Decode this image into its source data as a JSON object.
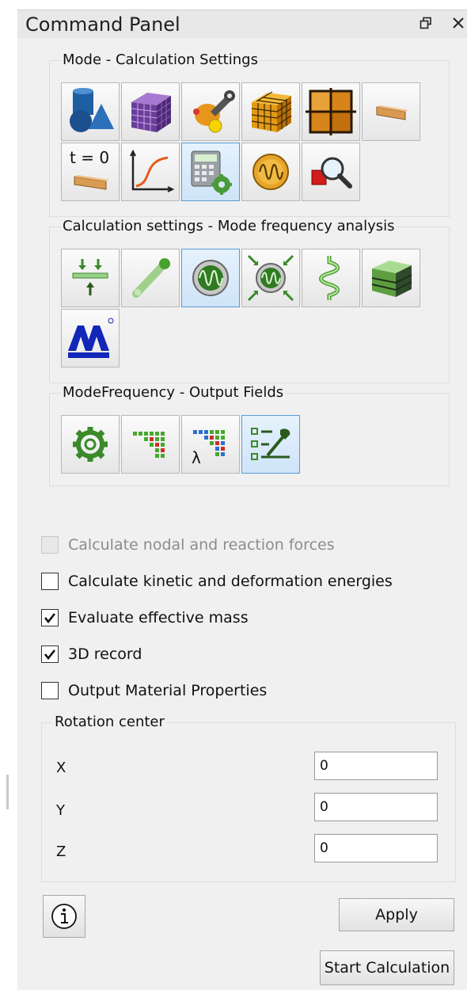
{
  "panel": {
    "title": "Command Panel",
    "float_icon": "restore-icon",
    "close_icon": "close-icon"
  },
  "mode_group": {
    "title": "Mode - Calculation Settings",
    "buttons": [
      {
        "icon": "geometry-icon",
        "active": false
      },
      {
        "icon": "mesh-cube-icon",
        "active": false
      },
      {
        "icon": "tools-icon",
        "active": false
      },
      {
        "icon": "grid-cube-icon",
        "active": false
      },
      {
        "icon": "plate-grid-icon",
        "active": false
      },
      {
        "icon": "beam-icon",
        "active": false
      },
      {
        "icon": "initial-time-icon",
        "label": "t = 0",
        "active": false
      },
      {
        "icon": "curve-graph-icon",
        "active": false
      },
      {
        "icon": "calculation-settings-icon",
        "active": true
      },
      {
        "icon": "oscillation-icon",
        "active": false
      },
      {
        "icon": "inspect-icon",
        "active": false
      }
    ]
  },
  "calc_group": {
    "title": "Calculation settings - Mode frequency analysis",
    "buttons": [
      {
        "icon": "supports-icon",
        "active": false
      },
      {
        "icon": "rod-icon",
        "active": false
      },
      {
        "icon": "mode-frequency-icon",
        "active": true
      },
      {
        "icon": "mode-frequency-loads-icon",
        "active": false
      },
      {
        "icon": "spring-icon",
        "active": false
      },
      {
        "icon": "layered-block-icon",
        "active": false
      },
      {
        "icon": "brand-logo-icon",
        "active": false
      }
    ]
  },
  "output_group": {
    "title": "ModeFrequency - Output Fields",
    "buttons": [
      {
        "icon": "gear-icon",
        "active": false
      },
      {
        "icon": "field-matrix-icon",
        "active": false
      },
      {
        "icon": "lambda-matrix-icon",
        "active": false
      },
      {
        "icon": "list-settings-icon",
        "active": true
      }
    ]
  },
  "options": [
    {
      "label": "Calculate nodal and reaction forces",
      "checked": false,
      "disabled": true
    },
    {
      "label": "Calculate kinetic and deformation energies",
      "checked": false,
      "disabled": false
    },
    {
      "label": "Evaluate effective mass",
      "checked": true,
      "disabled": false
    },
    {
      "label": "3D record",
      "checked": true,
      "disabled": false
    },
    {
      "label": "Output Material Properties",
      "checked": false,
      "disabled": false
    }
  ],
  "rotation": {
    "title": "Rotation center",
    "x_label": "X",
    "x_value": "0",
    "y_label": "Y",
    "y_value": "0",
    "z_label": "Z",
    "z_value": "0"
  },
  "footer": {
    "info_icon": "info-icon",
    "apply_label": "Apply",
    "start_label": "Start Calculation"
  },
  "colors": {
    "panel_bg": "#f0f0f0",
    "active_border": "#5b9bd5",
    "active_bg": "#d7e9fa"
  }
}
